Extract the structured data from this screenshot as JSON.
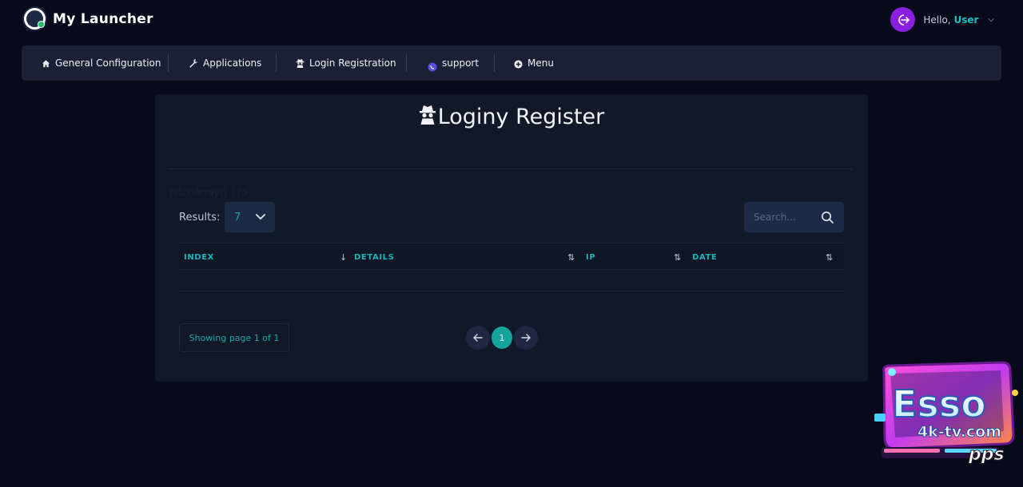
{
  "app": {
    "title": "My Launcher"
  },
  "user": {
    "greeting": "Hello,",
    "name": "User"
  },
  "nav": {
    "items": [
      {
        "label": "General Configuration",
        "icon": "home-icon"
      },
      {
        "label": "Applications",
        "icon": "wrench-icon"
      },
      {
        "label": "Login Registration",
        "icon": "spy-icon"
      },
      {
        "label": "support",
        "icon": "whatsapp-icon"
      },
      {
        "label": "Menu",
        "icon": "plus-circle-icon"
      }
    ]
  },
  "page": {
    "title": "Loginy Register",
    "debug_text": "fetchArray() {?>"
  },
  "table": {
    "results_label": "Results:",
    "results_value": "7",
    "search_placeholder": "Search...",
    "columns": [
      "INDEX",
      "DETAILS",
      "IP",
      "DATE"
    ],
    "rows": []
  },
  "pagination": {
    "info": "Showing page 1 of 1",
    "current": "1"
  },
  "watermark": {
    "line1": "Esso",
    "line2": "4k-tv.com",
    "line3": "pps"
  },
  "colors": {
    "background": "#070a1a",
    "navbar": "#1a2035",
    "card": "#111828",
    "accent": "#19b4b6",
    "avatar": "#8a1fe0",
    "active_page": "#13a49c"
  }
}
